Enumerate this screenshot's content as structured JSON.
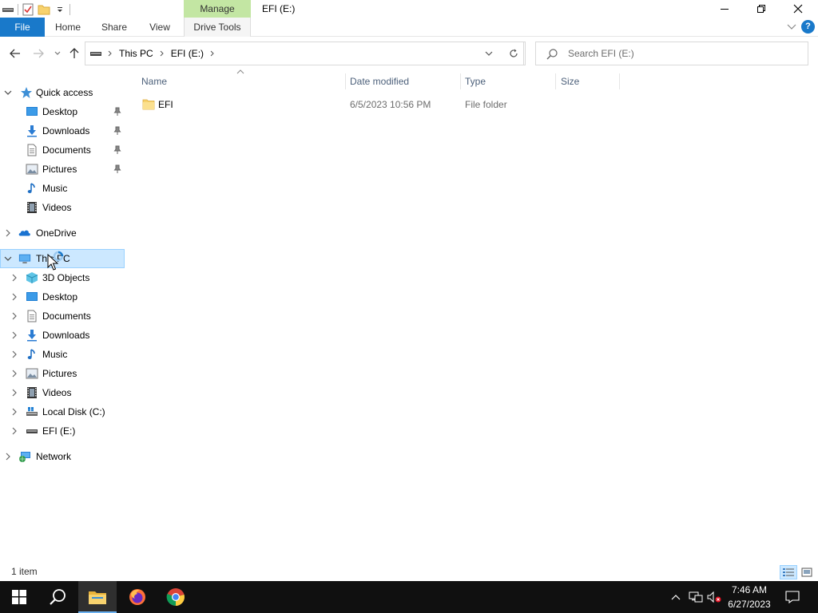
{
  "window": {
    "title": "EFI (E:)",
    "contextual_tab": "Manage",
    "controls": [
      "minimize",
      "restore",
      "close"
    ]
  },
  "ribbon": {
    "tabs": [
      {
        "label": "File"
      },
      {
        "label": "Home"
      },
      {
        "label": "Share"
      },
      {
        "label": "View"
      },
      {
        "label": "Drive Tools"
      }
    ]
  },
  "address": {
    "crumbs": [
      "This PC",
      "EFI (E:)"
    ],
    "drive_icon": "drive-icon"
  },
  "search": {
    "placeholder": "Search EFI (E:)"
  },
  "navpane": {
    "quick_access": "Quick access",
    "quick_items": [
      {
        "label": "Desktop",
        "icon": "desktop-icon",
        "pinned": true
      },
      {
        "label": "Downloads",
        "icon": "downloads-icon",
        "pinned": true
      },
      {
        "label": "Documents",
        "icon": "documents-icon",
        "pinned": true
      },
      {
        "label": "Pictures",
        "icon": "pictures-icon",
        "pinned": true
      },
      {
        "label": "Music",
        "icon": "music-icon",
        "pinned": false
      },
      {
        "label": "Videos",
        "icon": "videos-icon",
        "pinned": false
      }
    ],
    "onedrive": "OneDrive",
    "this_pc": "This PC",
    "pc_items": [
      {
        "label": "3D Objects",
        "icon": "3d-objects-icon"
      },
      {
        "label": "Desktop",
        "icon": "desktop-icon"
      },
      {
        "label": "Documents",
        "icon": "documents-icon"
      },
      {
        "label": "Downloads",
        "icon": "downloads-icon"
      },
      {
        "label": "Music",
        "icon": "music-icon"
      },
      {
        "label": "Pictures",
        "icon": "pictures-icon"
      },
      {
        "label": "Videos",
        "icon": "videos-icon"
      },
      {
        "label": "Local Disk (C:)",
        "icon": "local-disk-icon"
      },
      {
        "label": "EFI (E:)",
        "icon": "drive-icon"
      }
    ],
    "network": "Network"
  },
  "columns": {
    "name": "Name",
    "date": "Date modified",
    "type": "Type",
    "size": "Size"
  },
  "files": [
    {
      "name": "EFI",
      "date": "6/5/2023 10:56 PM",
      "type": "File folder",
      "size": ""
    }
  ],
  "status": {
    "count": "1 item"
  },
  "taskbar": {
    "time": "7:46 AM",
    "date": "6/27/2023"
  },
  "colors": {
    "accent": "#1979ca",
    "manage_tab": "#c3e6a3",
    "selection": "#cce8ff",
    "taskbar": "#101010",
    "folder": "#f7d26e"
  }
}
